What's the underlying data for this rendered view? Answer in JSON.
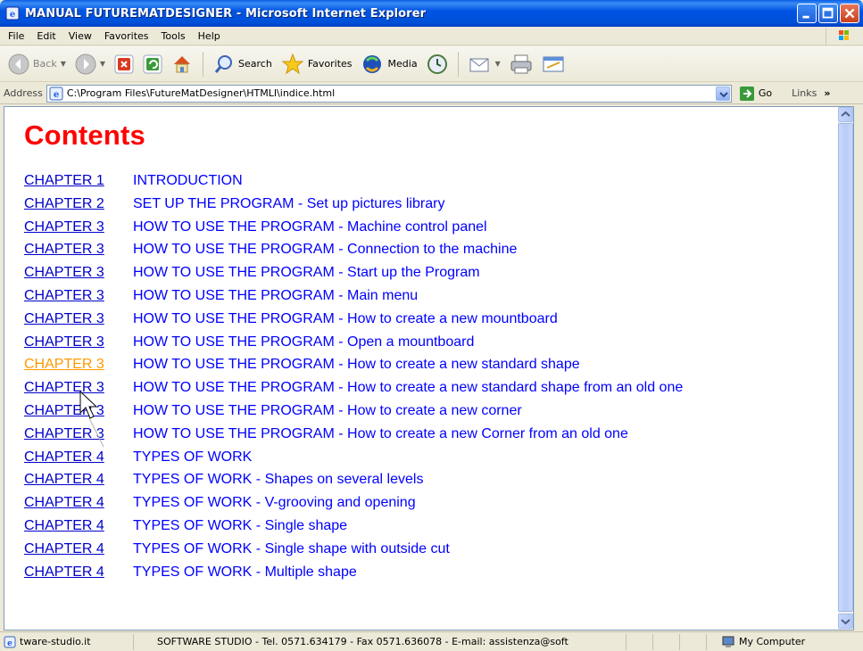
{
  "window": {
    "title": "MANUAL FUTUREMATDESIGNER - Microsoft Internet Explorer"
  },
  "menu": [
    "File",
    "Edit",
    "View",
    "Favorites",
    "Tools",
    "Help"
  ],
  "toolbar": {
    "back_label": "Back",
    "search_label": "Search",
    "favorites_label": "Favorites",
    "media_label": "Media"
  },
  "address": {
    "label": "Address",
    "url": "C:\\Program Files\\FutureMatDesigner\\HTMLI\\indice.html",
    "go_label": "Go",
    "links_label": "Links"
  },
  "page": {
    "heading": "Contents",
    "toc": [
      {
        "chapter": "CHAPTER 1",
        "title": "INTRODUCTION"
      },
      {
        "chapter": "CHAPTER 2",
        "title": "SET UP THE PROGRAM - Set up pictures library"
      },
      {
        "chapter": "CHAPTER 3",
        "title": "HOW TO USE THE PROGRAM - Machine control panel"
      },
      {
        "chapter": "CHAPTER 3",
        "title": "HOW TO USE THE PROGRAM - Connection to the machine"
      },
      {
        "chapter": "CHAPTER 3",
        "title": "HOW TO USE THE PROGRAM - Start up the Program"
      },
      {
        "chapter": "CHAPTER 3",
        "title": "HOW TO USE THE PROGRAM - Main menu"
      },
      {
        "chapter": "CHAPTER 3",
        "title": "HOW TO USE THE PROGRAM - How to create a new mountboard"
      },
      {
        "chapter": "CHAPTER 3",
        "title": "HOW TO USE THE PROGRAM - Open a mountboard"
      },
      {
        "chapter": "CHAPTER 3",
        "title": "HOW TO USE THE PROGRAM - How to create a new standard shape"
      },
      {
        "chapter": "CHAPTER 3",
        "title": "HOW TO USE THE PROGRAM - How to create a new standard shape from an old one"
      },
      {
        "chapter": "CHAPTER 3",
        "title": "HOW TO USE THE PROGRAM - How to create a new corner"
      },
      {
        "chapter": "CHAPTER 3",
        "title": "HOW TO USE THE PROGRAM - How to create a new Corner from an old one"
      },
      {
        "chapter": "CHAPTER 4",
        "title": "TYPES OF WORK"
      },
      {
        "chapter": "CHAPTER 4",
        "title": "TYPES OF WORK - Shapes on several levels"
      },
      {
        "chapter": "CHAPTER 4",
        "title": "TYPES OF WORK - V-grooving and opening"
      },
      {
        "chapter": "CHAPTER 4",
        "title": "TYPES OF WORK - Single shape"
      },
      {
        "chapter": "CHAPTER 4",
        "title": "TYPES OF WORK - Single shape with outside cut"
      },
      {
        "chapter": "CHAPTER 4",
        "title": "TYPES OF WORK - Multiple shape"
      }
    ],
    "hovered_index": 8
  },
  "status": {
    "left": "tware-studio.it",
    "middle": "SOFTWARE STUDIO - Tel. 0571.634179 - Fax 0571.636078 - E-mail: assistenza@soft",
    "zone": "My Computer"
  },
  "colors": {
    "heading": "#ff0000",
    "link": "#0000cc",
    "link_hover": "#ff9900",
    "titlebar": "#0054e3"
  }
}
